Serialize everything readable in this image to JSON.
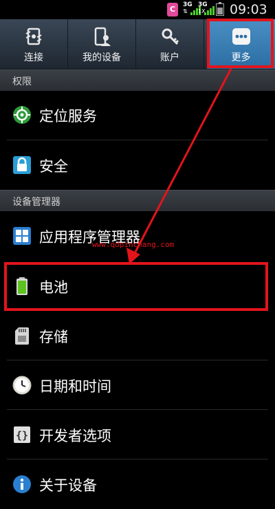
{
  "status_bar": {
    "app_badge": "C",
    "net1_top": "3G",
    "net2_top": "3G",
    "net2_bottom": "1X",
    "time": "09:03"
  },
  "tabs": [
    {
      "label": "连接",
      "icon": "connections-icon"
    },
    {
      "label": "我的设备",
      "icon": "my-device-icon"
    },
    {
      "label": "账户",
      "icon": "accounts-icon"
    },
    {
      "label": "更多",
      "icon": "more-icon"
    }
  ],
  "sections": [
    {
      "title": "权限"
    },
    {
      "title": "设备管理器"
    }
  ],
  "items": [
    {
      "label": "定位服务",
      "icon": "location-icon"
    },
    {
      "label": "安全",
      "icon": "lock-icon"
    },
    {
      "label": "应用程序管理器",
      "icon": "apps-grid-icon"
    },
    {
      "label": "电池",
      "icon": "battery-icon"
    },
    {
      "label": "存储",
      "icon": "sd-card-icon"
    },
    {
      "label": "日期和时间",
      "icon": "clock-icon"
    },
    {
      "label": "开发者选项",
      "icon": "braces-icon"
    },
    {
      "label": "关于设备",
      "icon": "info-icon"
    }
  ],
  "watermark": "www.qdpinchang.com",
  "colors": {
    "highlight": "#e3141c",
    "active_tab": "#3a7db3",
    "battery_green": "#5cc31f"
  }
}
